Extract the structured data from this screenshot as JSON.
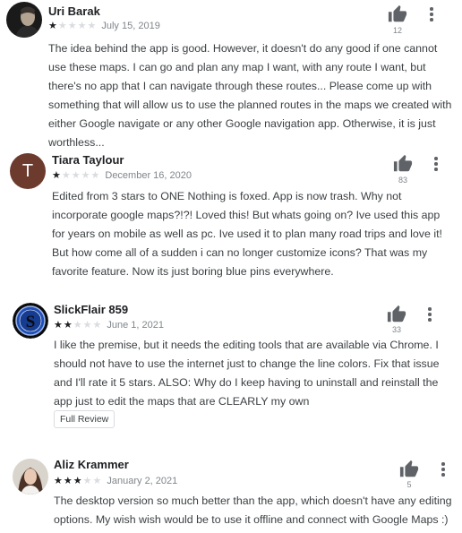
{
  "reviews": [
    {
      "name": "Uri Barak",
      "rating": 1,
      "date": "July 15, 2019",
      "helpful_count": "12",
      "text": "The idea behind the app is good. However, it doesn't do any good if one cannot use these maps. I can go and plan any map I want, with any route I want, but there's no app that I can navigate through these routes... Please come up with something that will allow us to use the planned routes in the maps we created with either Google navigate or any other Google navigation app. Otherwise, it is just worthless..."
    },
    {
      "name": "Tiara Taylour",
      "rating": 1,
      "date": "December 16, 2020",
      "helpful_count": "83",
      "avatar_letter": "T",
      "avatar_color": "#6d3b2e",
      "text": "Edited from 3 stars to ONE Nothing is foxed. App is now trash. Why not incorporate google maps?!?! Loved this! But whats going on? Ive used this app for years on mobile as well as pc. Ive used it to plan many road trips and love it! But how come all of a sudden i can no longer customize icons? That was my favorite feature. Now its just boring blue pins everywhere."
    },
    {
      "name": "SlickFlair 859",
      "rating": 2,
      "date": "June 1, 2021",
      "helpful_count": "33",
      "avatar_letter": "S",
      "text": "I like the premise, but it needs the editing tools that are available via Chrome. I should not have to use the internet just to change the line colors. Fix that issue and I'll rate it 5 stars. ALSO: Why do I keep having to uninstall and reinstall the app just to edit the maps that are CLEARLY my own",
      "full_review_label": "Full Review"
    },
    {
      "name": "Aliz Krammer",
      "rating": 3,
      "date": "January 2, 2021",
      "helpful_count": "5",
      "text": "The desktop version so much better than the app, which doesn't have any editing options. My wish wish would be to use it offline and connect with Google Maps :)"
    }
  ],
  "colors": {
    "star_filled": "#202124",
    "star_empty": "#dadce0",
    "meta_text": "#80868b",
    "body_text": "#3c4043"
  },
  "icons": {
    "helpful": "thumbs-up-icon",
    "more": "more-vert-icon"
  }
}
